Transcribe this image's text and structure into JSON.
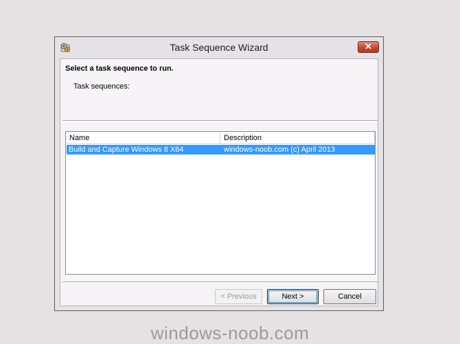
{
  "window": {
    "title": "Task Sequence Wizard",
    "close_symbol": "✕",
    "icon": "wizard-gear-icon"
  },
  "page": {
    "heading": "Select a task sequence to run.",
    "list_label": "Task sequences:"
  },
  "task_list": {
    "columns": [
      "Name",
      "Description"
    ],
    "rows": [
      {
        "name": "Build and Capture Windows 8 X64",
        "description": "windows-noob.com (c) April 2013",
        "selected": true
      }
    ]
  },
  "buttons": {
    "previous": "< Previous",
    "next": "Next >",
    "cancel": "Cancel"
  },
  "watermark": "windows-noob.com",
  "colors": {
    "selection": "#3399ff",
    "desktop": "#e6e2e3",
    "close_button": "#c9482f"
  }
}
